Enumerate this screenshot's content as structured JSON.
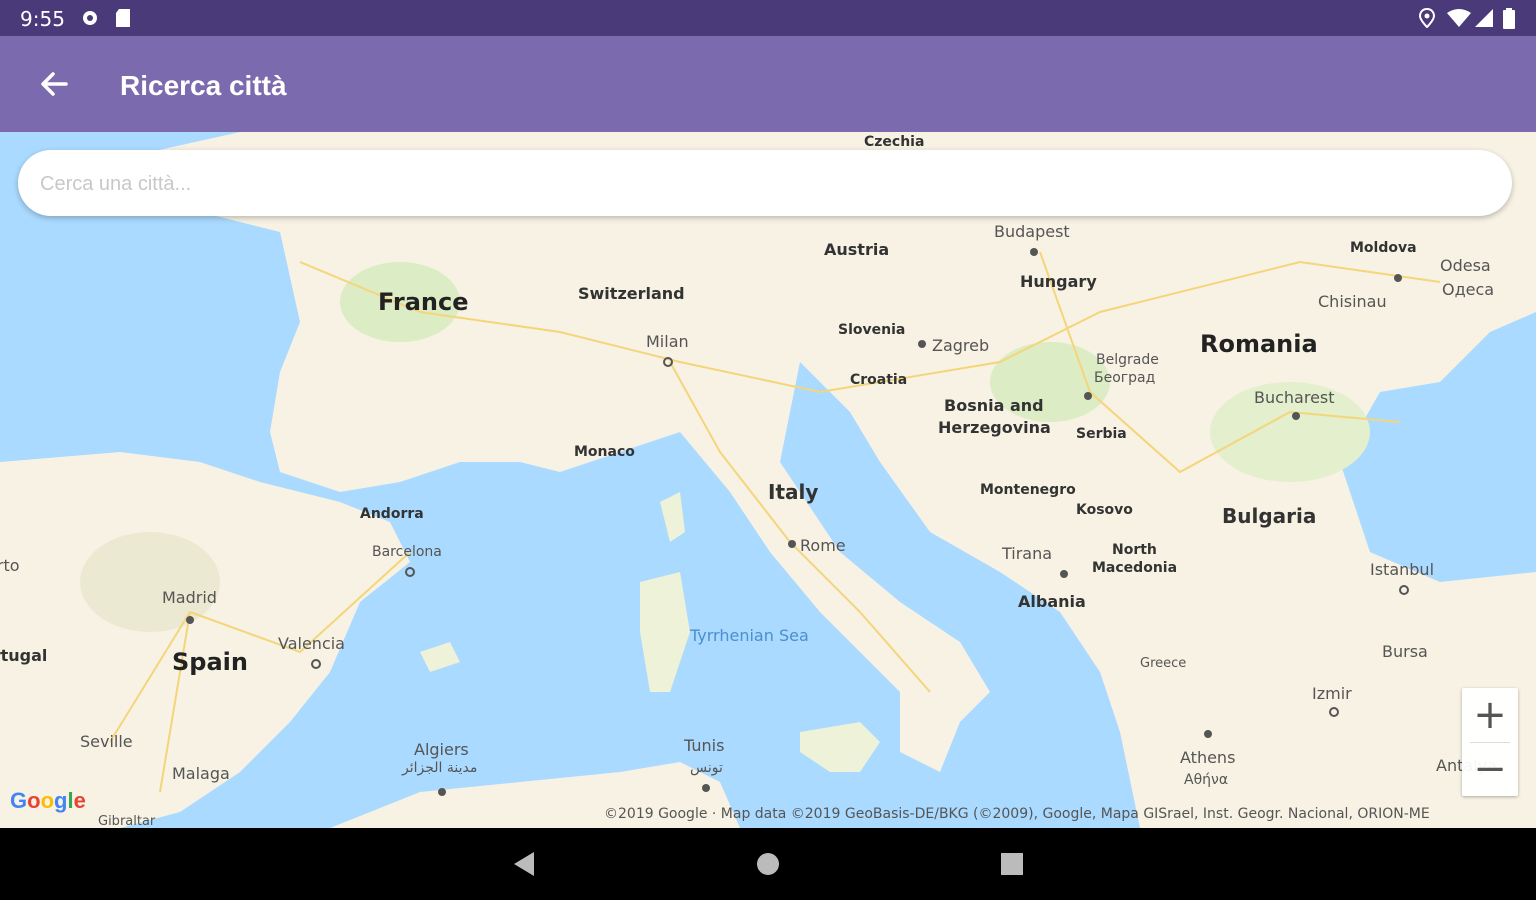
{
  "status_bar": {
    "time": "9:55"
  },
  "app_bar": {
    "title": "Ricerca città"
  },
  "search": {
    "placeholder": "Cerca una città..."
  },
  "map": {
    "countries_large": [
      "France",
      "Romania",
      "Spain"
    ],
    "countries": [
      "Italy",
      "Bulgaria",
      "Austria",
      "Switzerland",
      "Hungary",
      "Slovenia",
      "Croatia",
      "Bosnia and",
      "Herzegovina",
      "Serbia",
      "Montenegro",
      "Kosovo",
      "North",
      "Macedonia",
      "Albania",
      "Moldova",
      "Monaco",
      "Andorra",
      "Czechia",
      "Greece"
    ],
    "cities": [
      "Budapest",
      "Milan",
      "Zagreb",
      "Belgrade",
      "Београд",
      "Bucharest",
      "Chisinau",
      "Odesa",
      "Одеса",
      "Rome",
      "Tirana",
      "Barcelona",
      "Madrid",
      "Valencia",
      "Seville",
      "Malaga",
      "Algiers",
      "مدينة الجزائر",
      "Tunis",
      "تونس",
      "Athens",
      "Αθήνα",
      "Istanbul",
      "Bursa",
      "Izmir",
      "Gibraltar",
      "Porto",
      "Portugal",
      "Antalya"
    ],
    "sea": "Tyrrhenian Sea",
    "zoom_in": "+",
    "zoom_out": "−",
    "google_logo": "Google",
    "attribution": "©2019 Google · Map data ©2019 GeoBasis-DE/BKG (©2009), Google, Mapa GISrael, Inst. Geogr. Nacional, ORION-ME"
  }
}
